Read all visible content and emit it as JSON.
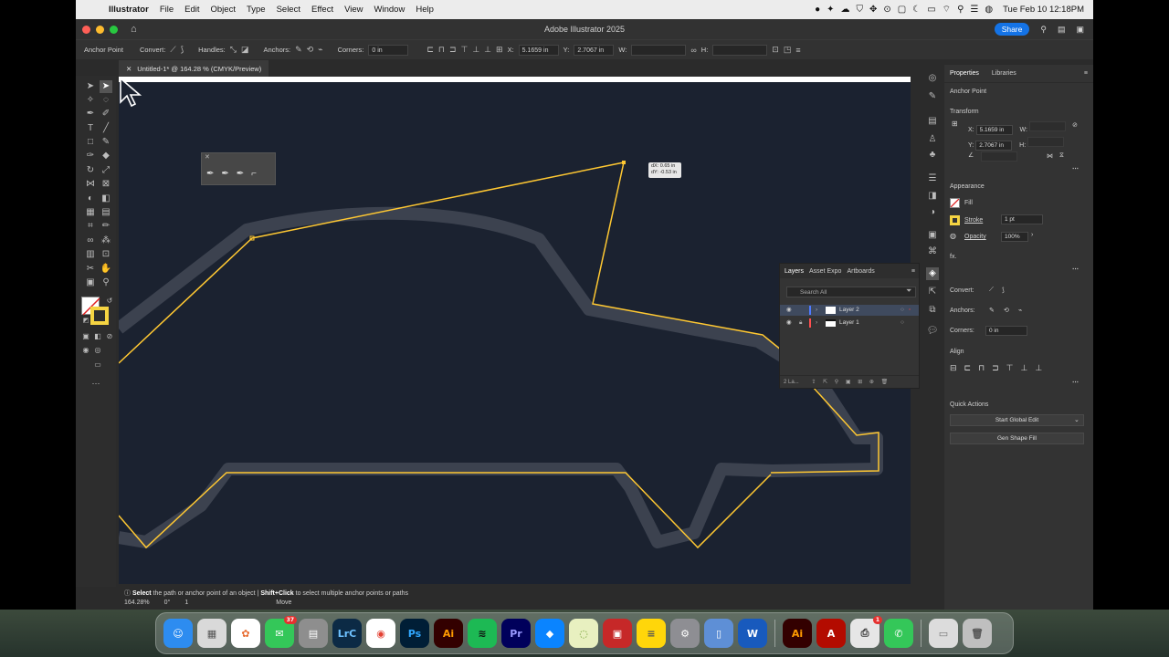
{
  "menubar": {
    "app_name": "Illustrator",
    "items": [
      "File",
      "Edit",
      "Object",
      "Type",
      "Select",
      "Effect",
      "View",
      "Window",
      "Help"
    ],
    "clock": "Tue Feb 10  12:18PM"
  },
  "window": {
    "title": "Adobe Illustrator 2025",
    "share_label": "Share"
  },
  "control_bar": {
    "mode": "Anchor Point",
    "convert_label": "Convert:",
    "handles_label": "Handles:",
    "anchors_label": "Anchors:",
    "corners_label": "Corners:",
    "corners_value": "0 in",
    "x_label": "X:",
    "x_value": "5.1659 in",
    "y_label": "Y:",
    "y_value": "2.7067 in",
    "w_label": "W:",
    "h_label": "H:"
  },
  "document": {
    "tab_title": "Untitled-1* @ 164.28 % (CMYK/Preview)",
    "tooltip_dx": "dX: 0.65 in",
    "tooltip_dy": "dY: -0.53 in"
  },
  "properties": {
    "tab_properties": "Properties",
    "tab_libraries": "Libraries",
    "selection": "Anchor Point",
    "transform_title": "Transform",
    "x_label": "X:",
    "x_value": "5.1659 in",
    "y_label": "Y:",
    "y_value": "2.7067 in",
    "w_label": "W:",
    "h_label": "H:",
    "appearance_title": "Appearance",
    "fill_label": "Fill",
    "stroke_label": "Stroke",
    "stroke_value": "1 pt",
    "opacity_label": "Opacity",
    "opacity_value": "100%",
    "fx_label": "fx.",
    "convert_label": "Convert:",
    "anchors_label": "Anchors:",
    "corners_label": "Corners:",
    "corners_value": "0 in",
    "align_title": "Align",
    "quick_actions_title": "Quick Actions",
    "start_global_edit": "Start Global Edit",
    "gen_shape_fill": "Gen Shape Fill"
  },
  "layers_panel": {
    "tab_layers": "Layers",
    "tab_assets": "Asset Expo",
    "tab_artboards": "Artboards",
    "search_placeholder": "Search All",
    "layers": [
      {
        "name": "Layer 2",
        "color": "#4f7bff"
      },
      {
        "name": "Layer 1",
        "color": "#ff4f4f"
      }
    ],
    "footer": "2 La..."
  },
  "status_bar": {
    "hint_part1": "Select",
    "hint_part2": " the path or anchor point of an object  |  ",
    "hint_part3": "Shift+Click",
    "hint_part4": " to select multiple anchor points or paths",
    "zoom": "164.28%",
    "rotation": "0°",
    "artboard": "1",
    "tool": "Move"
  },
  "colors": {
    "path_stroke": "#ffc832",
    "canvas_bg": "#1b2230",
    "accent": "#1473e6"
  },
  "dock": {
    "messages_badge": "37",
    "printer_badge": "1",
    "apps": [
      {
        "icon": "finder-icon",
        "label": "☺",
        "bg": "#2d8cf0"
      },
      {
        "icon": "launchpad-icon",
        "label": "▦",
        "bg": "#d9d9d9"
      },
      {
        "icon": "photos-icon",
        "label": "✿",
        "bg": "#ffffff"
      },
      {
        "icon": "messages-icon",
        "label": "✉",
        "bg": "#34c759"
      },
      {
        "icon": "calculator-icon",
        "label": "▤",
        "bg": "#8e8e8e"
      },
      {
        "icon": "lightroom-classic-icon",
        "label": "LrC",
        "bg": "#0c2a45"
      },
      {
        "icon": "chrome-icon",
        "label": "◉",
        "bg": "#ffffff"
      },
      {
        "icon": "photoshop-icon",
        "label": "Ps",
        "bg": "#001e36"
      },
      {
        "icon": "illustrator-icon",
        "label": "Ai",
        "bg": "#330000"
      },
      {
        "icon": "spotify-icon",
        "label": "≋",
        "bg": "#1db954"
      },
      {
        "icon": "premiere-icon",
        "label": "Pr",
        "bg": "#00005b"
      },
      {
        "icon": "location-icon",
        "label": "◆",
        "bg": "#0a84ff"
      },
      {
        "icon": "lumen-icon",
        "label": "◌",
        "bg": "#e8f0c0"
      },
      {
        "icon": "photo-booth-icon",
        "label": "▣",
        "bg": "#c62828"
      },
      {
        "icon": "notes-icon",
        "label": "≡",
        "bg": "#ffd60a"
      },
      {
        "icon": "system-settings-icon",
        "label": "⚙",
        "bg": "#8e8e93"
      },
      {
        "icon": "simulator-icon",
        "label": "▯",
        "bg": "#5e8fd6"
      },
      {
        "icon": "word-icon",
        "label": "W",
        "bg": "#185abd"
      },
      {
        "icon": "illustrator-icon-2",
        "label": "Ai",
        "bg": "#330000"
      },
      {
        "icon": "acrobat-icon",
        "label": "A",
        "bg": "#b30b00"
      },
      {
        "icon": "printer-icon",
        "label": "⎙",
        "bg": "#e6e6e6"
      },
      {
        "icon": "phone-icon",
        "label": "✆",
        "bg": "#34c759"
      },
      {
        "icon": "folder-icon",
        "label": "▭",
        "bg": "#dcdcdc"
      },
      {
        "icon": "trash-icon",
        "label": "🗑",
        "bg": "#bfbfbf"
      }
    ]
  }
}
